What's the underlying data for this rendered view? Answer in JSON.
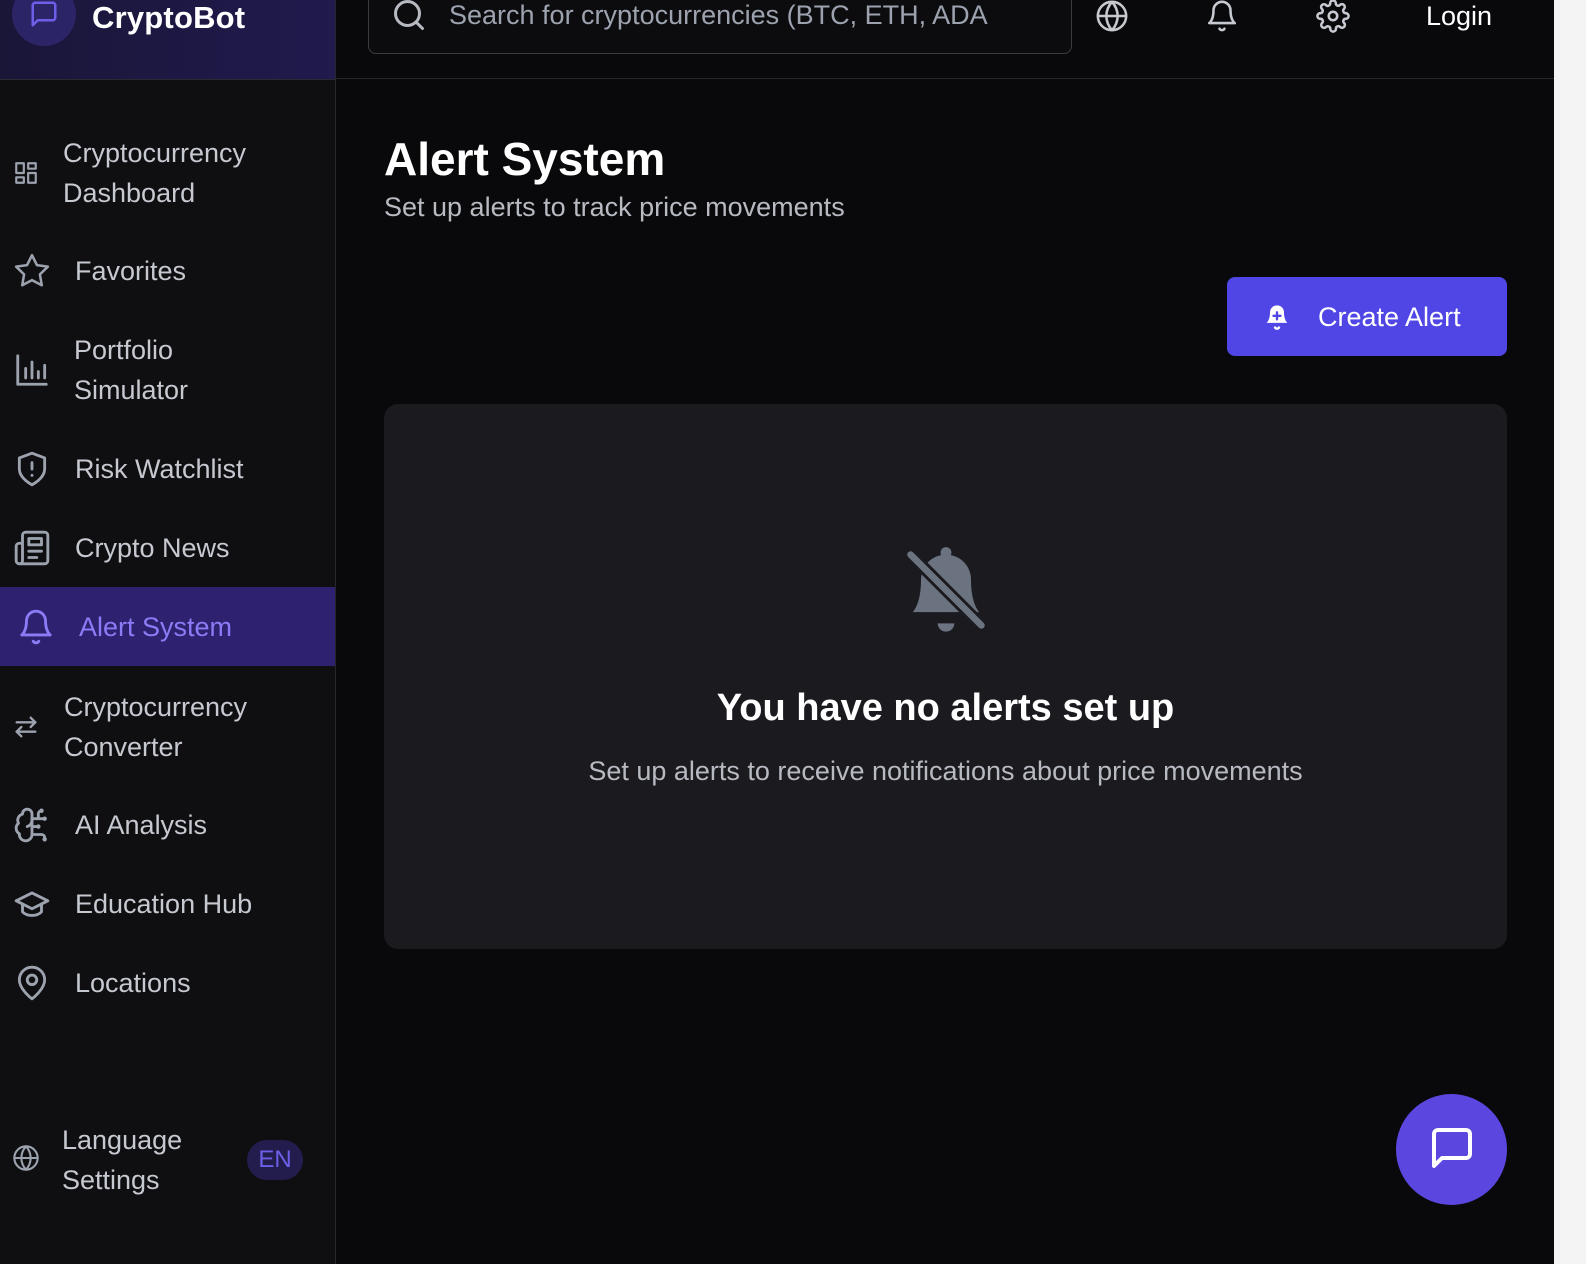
{
  "brand": {
    "name": "CryptoBot",
    "icon": "message-square-icon"
  },
  "sidebar": {
    "items": [
      {
        "label": "Cryptocurrency Dashboard",
        "icon": "layout-grid-icon"
      },
      {
        "label": "Favorites",
        "icon": "star-icon"
      },
      {
        "label": "Portfolio Simulator",
        "icon": "bar-chart-icon"
      },
      {
        "label": "Risk Watchlist",
        "icon": "shield-alert-icon"
      },
      {
        "label": "Crypto News",
        "icon": "newspaper-icon"
      },
      {
        "label": "Alert System",
        "icon": "bell-icon",
        "active": true
      },
      {
        "label": "Cryptocurrency Converter",
        "icon": "arrows-left-right-icon"
      },
      {
        "label": "AI Analysis",
        "icon": "brain-circuit-icon"
      },
      {
        "label": "Education Hub",
        "icon": "graduation-cap-icon"
      },
      {
        "label": "Locations",
        "icon": "map-pin-icon"
      }
    ],
    "language": {
      "label": "Language Settings",
      "badge": "EN",
      "icon": "globe-icon"
    }
  },
  "topbar": {
    "search_placeholder": "Search for cryptocurrencies (BTC, ETH, ADA",
    "login_label": "Login",
    "icons": [
      "globe-icon",
      "bell-icon",
      "gear-icon"
    ]
  },
  "main": {
    "title": "Alert System",
    "subtitle": "Set up alerts to track price movements",
    "create_button_label": "Create Alert",
    "empty": {
      "title": "You have no alerts set up",
      "subtitle": "Set up alerts to receive notifications about price movements",
      "icon": "bell-off-icon"
    }
  },
  "colors": {
    "accent": "#4f46e5",
    "active_bg": "#2e2170",
    "active_text": "#8b7cf6",
    "background": "#09090b",
    "card": "#1a1a1f"
  }
}
